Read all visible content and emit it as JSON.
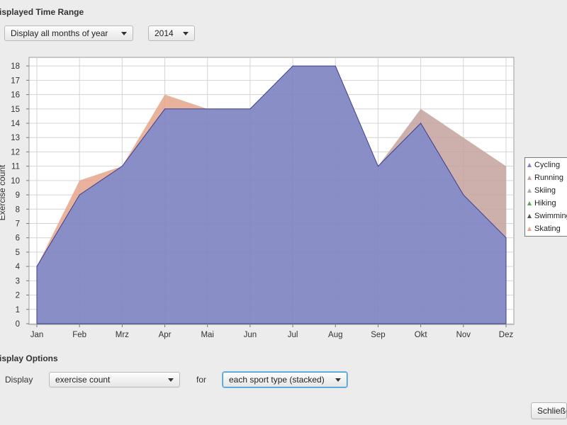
{
  "time_range": {
    "title": "isplayed Time Range",
    "month_select": "Display all months of year",
    "year_select": "2014"
  },
  "display_options": {
    "title": "isplay Options",
    "display_label": "Display",
    "value_select": "exercise count",
    "for_label": "for",
    "mode_select": "each sport type (stacked)"
  },
  "close_button": "Schließen",
  "colors": {
    "cycling": "#7f84c2",
    "cycling_line": "#3c3f8e",
    "running": "#c4a19c",
    "skating": "#e5a58b",
    "skiing": "#a9a9a9",
    "hiking": "#5aa55e",
    "swimming": "#555555"
  },
  "chart_data": {
    "type": "area",
    "stacked": true,
    "categories": [
      "Jan",
      "Feb",
      "Mrz",
      "Apr",
      "Mai",
      "Jun",
      "Jul",
      "Aug",
      "Sep",
      "Okt",
      "Nov",
      "Dez"
    ],
    "ylabel": "Exercise count",
    "ylim": [
      0,
      18.6
    ],
    "yticks": [
      0,
      1,
      2,
      3,
      4,
      5,
      6,
      7,
      8,
      9,
      10,
      11,
      12,
      13,
      14,
      15,
      16,
      17,
      18
    ],
    "grid": true,
    "legend_position": "right",
    "legend": [
      "Cycling",
      "Running",
      "Skiing",
      "Hiking",
      "Swimming",
      "Skating"
    ],
    "series": [
      {
        "name": "Cycling",
        "values": [
          4,
          9,
          11,
          15,
          15,
          15,
          18,
          18,
          11,
          14,
          9,
          6
        ]
      },
      {
        "name": "Running",
        "values": [
          0,
          0,
          0,
          0,
          0,
          0,
          0,
          0,
          0,
          1,
          4,
          5
        ]
      },
      {
        "name": "Skiing",
        "values": [
          0,
          0,
          0,
          0,
          0,
          0,
          0,
          0,
          0,
          0,
          0,
          0
        ]
      },
      {
        "name": "Hiking",
        "values": [
          0,
          0,
          0,
          0,
          0,
          0,
          0,
          0,
          0,
          0,
          0,
          0
        ]
      },
      {
        "name": "Swimming",
        "values": [
          0,
          0,
          0,
          0,
          0,
          0,
          0,
          0,
          0,
          0,
          0,
          0
        ]
      },
      {
        "name": "Skating",
        "values": [
          0,
          1,
          0,
          1,
          0,
          0,
          0,
          0,
          0,
          0,
          0,
          0
        ]
      }
    ]
  }
}
